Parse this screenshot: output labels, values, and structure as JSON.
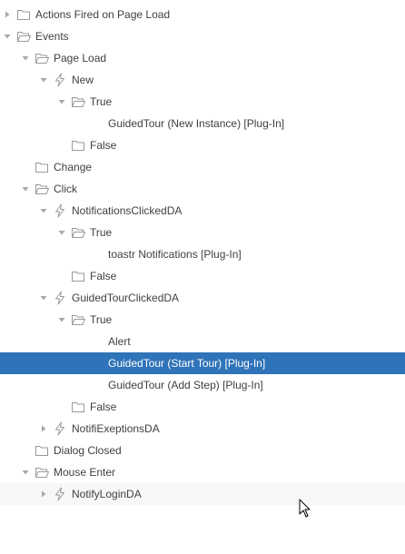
{
  "colors": {
    "selected_bg": "#2f73b8",
    "icon_gray": "#9a9a9a",
    "text": "#404040"
  },
  "tree": [
    {
      "label": "Actions Fired on Page Load",
      "depth": 0,
      "toggle": "collapsed",
      "icon": "folder-icon"
    },
    {
      "label": "Events",
      "depth": 0,
      "toggle": "expanded",
      "icon": "folder-open-icon"
    },
    {
      "label": "Page Load",
      "depth": 1,
      "toggle": "expanded",
      "icon": "folder-open-icon"
    },
    {
      "label": "New",
      "depth": 2,
      "toggle": "expanded",
      "icon": "lightning-icon"
    },
    {
      "label": "True",
      "depth": 3,
      "toggle": "expanded",
      "icon": "folder-open-icon"
    },
    {
      "label": "GuidedTour (New Instance) [Plug-In]",
      "depth": 4,
      "toggle": "none",
      "icon": "none"
    },
    {
      "label": "False",
      "depth": 3,
      "toggle": "none",
      "icon": "folder-icon"
    },
    {
      "label": "Change",
      "depth": 1,
      "toggle": "none",
      "icon": "folder-icon"
    },
    {
      "label": "Click",
      "depth": 1,
      "toggle": "expanded",
      "icon": "folder-open-icon"
    },
    {
      "label": "NotificationsClickedDA",
      "depth": 2,
      "toggle": "expanded",
      "icon": "lightning-icon"
    },
    {
      "label": "True",
      "depth": 3,
      "toggle": "expanded",
      "icon": "folder-open-icon"
    },
    {
      "label": "toastr Notifications [Plug-In]",
      "depth": 4,
      "toggle": "none",
      "icon": "none"
    },
    {
      "label": "False",
      "depth": 3,
      "toggle": "none",
      "icon": "folder-icon"
    },
    {
      "label": "GuidedTourClickedDA",
      "depth": 2,
      "toggle": "expanded",
      "icon": "lightning-icon"
    },
    {
      "label": "True",
      "depth": 3,
      "toggle": "expanded",
      "icon": "folder-open-icon"
    },
    {
      "label": "Alert",
      "depth": 4,
      "toggle": "none",
      "icon": "none"
    },
    {
      "label": "GuidedTour (Start Tour) [Plug-In]",
      "depth": 4,
      "toggle": "none",
      "icon": "none",
      "selected": true
    },
    {
      "label": "GuidedTour (Add Step) [Plug-In]",
      "depth": 4,
      "toggle": "none",
      "icon": "none"
    },
    {
      "label": "False",
      "depth": 3,
      "toggle": "none",
      "icon": "folder-icon"
    },
    {
      "label": "NotifiExeptionsDA",
      "depth": 2,
      "toggle": "collapsed",
      "icon": "lightning-icon"
    },
    {
      "label": "Dialog Closed",
      "depth": 1,
      "toggle": "none",
      "icon": "folder-icon"
    },
    {
      "label": "Mouse Enter",
      "depth": 1,
      "toggle": "expanded",
      "icon": "folder-open-icon"
    },
    {
      "label": "NotifyLoginDA",
      "depth": 2,
      "toggle": "collapsed",
      "icon": "lightning-icon",
      "hover": true
    }
  ],
  "cursor": {
    "icon": "mouse-pointer-icon"
  }
}
